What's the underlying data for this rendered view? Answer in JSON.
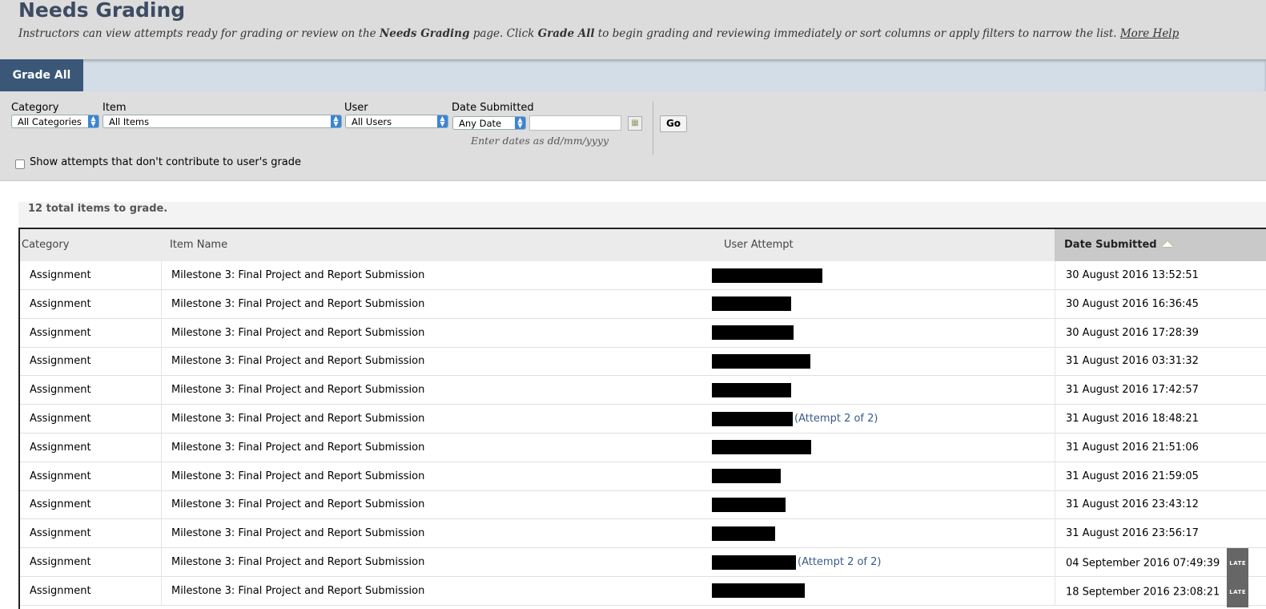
{
  "header": {
    "title": "Needs Grading",
    "desc_1": "Instructors can view attempts ready for grading or review on the ",
    "desc_b1": "Needs Grading",
    "desc_2": " page. Click ",
    "desc_b2": "Grade All",
    "desc_3": " to begin grading and reviewing immediately or sort columns or apply filters to narrow the list. ",
    "more_help": "More Help"
  },
  "actions": {
    "grade_all": "Grade All"
  },
  "filters": {
    "category_label": "Category",
    "category_value": "All Categories",
    "item_label": "Item",
    "item_value": "All Items",
    "user_label": "User",
    "user_value": "All Users",
    "date_label": "Date Submitted",
    "date_value": "Any Date",
    "date_hint": "Enter dates as dd/mm/yyyy",
    "go": "Go",
    "checkbox_label": "Show attempts that don't contribute to user's grade"
  },
  "summary": "12 total items to grade.",
  "columns": {
    "category": "Category",
    "item_name": "Item Name",
    "user_attempt": "User Attempt",
    "date_submitted": "Date Submitted"
  },
  "rows": [
    {
      "category": "Assignment",
      "item": "Milestone 3: Final Project and Report Submission",
      "attempt": "",
      "date": "30 August 2016 13:52:51",
      "late": ""
    },
    {
      "category": "Assignment",
      "item": "Milestone 3: Final Project and Report Submission",
      "attempt": "",
      "date": "30 August 2016 16:36:45",
      "late": ""
    },
    {
      "category": "Assignment",
      "item": "Milestone 3: Final Project and Report Submission",
      "attempt": "",
      "date": "30 August 2016 17:28:39",
      "late": ""
    },
    {
      "category": "Assignment",
      "item": "Milestone 3: Final Project and Report Submission",
      "attempt": "",
      "date": "31 August 2016 03:31:32",
      "late": ""
    },
    {
      "category": "Assignment",
      "item": "Milestone 3: Final Project and Report Submission",
      "attempt": "",
      "date": "31 August 2016 17:42:57",
      "late": ""
    },
    {
      "category": "Assignment",
      "item": "Milestone 3: Final Project and Report Submission",
      "attempt": "(Attempt 2 of 2)",
      "date": "31 August 2016 18:48:21",
      "late": ""
    },
    {
      "category": "Assignment",
      "item": "Milestone 3: Final Project and Report Submission",
      "attempt": "",
      "date": "31 August 2016 21:51:06",
      "late": ""
    },
    {
      "category": "Assignment",
      "item": "Milestone 3: Final Project and Report Submission",
      "attempt": "",
      "date": "31 August 2016 21:59:05",
      "late": ""
    },
    {
      "category": "Assignment",
      "item": "Milestone 3: Final Project and Report Submission",
      "attempt": "",
      "date": "31 August 2016 23:43:12",
      "late": ""
    },
    {
      "category": "Assignment",
      "item": "Milestone 3: Final Project and Report Submission",
      "attempt": "",
      "date": "31 August 2016 23:56:17",
      "late": ""
    },
    {
      "category": "Assignment",
      "item": "Milestone 3: Final Project and Report Submission",
      "attempt": "(Attempt 2 of 2)",
      "date": "04 September 2016 07:49:39",
      "late": "LATE"
    },
    {
      "category": "Assignment",
      "item": "Milestone 3: Final Project and Report Submission",
      "attempt": "",
      "date": "18 September 2016 23:08:21",
      "late": "LATE"
    }
  ]
}
